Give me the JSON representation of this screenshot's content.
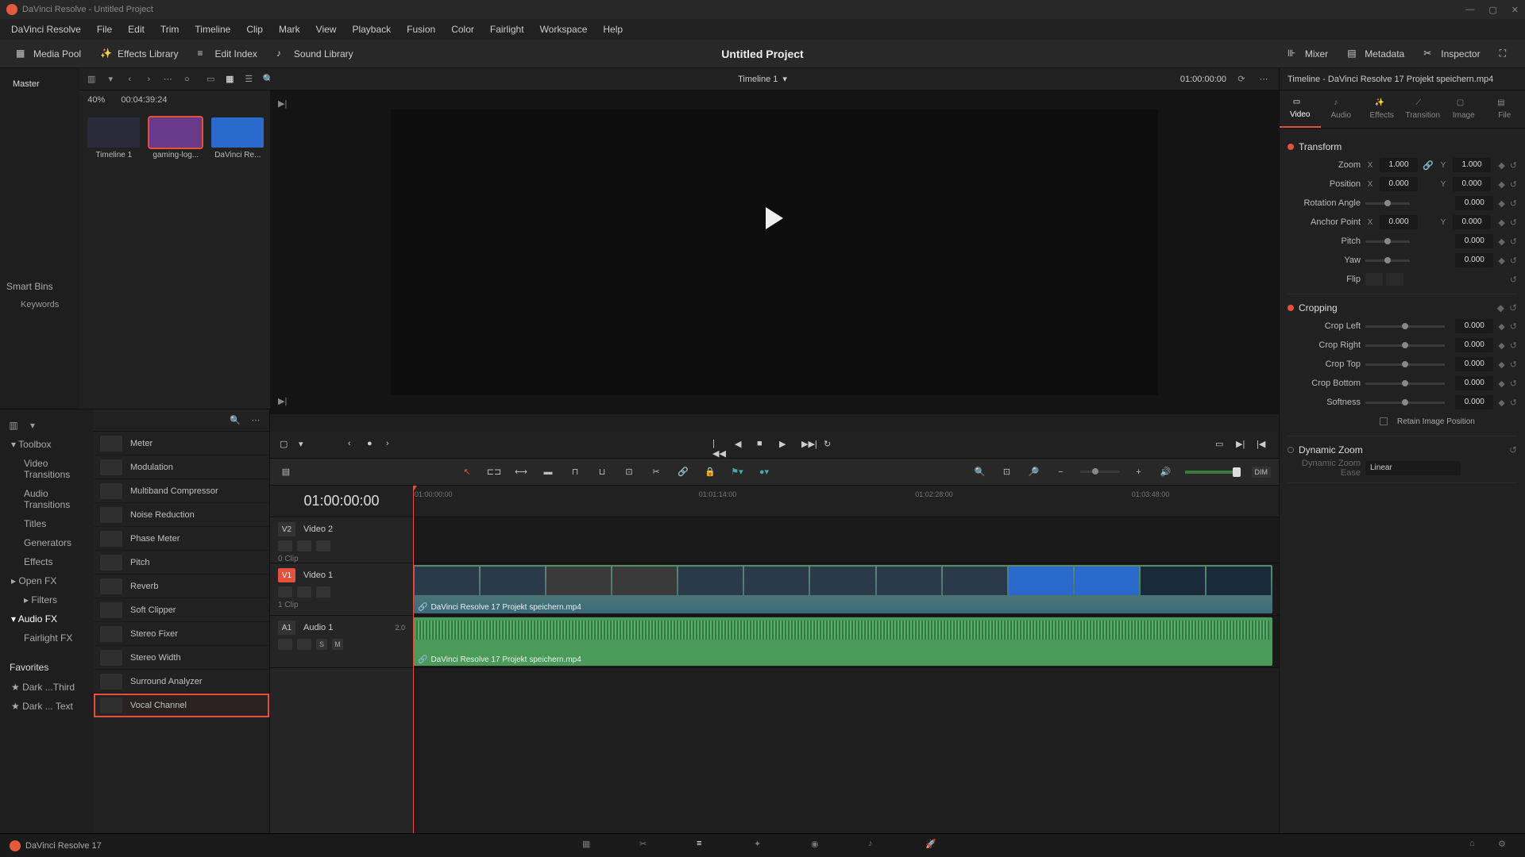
{
  "titlebar": {
    "text": "DaVinci Resolve - Untitled Project"
  },
  "menu": [
    "DaVinci Resolve",
    "File",
    "Edit",
    "Trim",
    "Timeline",
    "Clip",
    "Mark",
    "View",
    "Playback",
    "Fusion",
    "Color",
    "Fairlight",
    "Workspace",
    "Help"
  ],
  "toolbar": {
    "media_pool": "Media Pool",
    "effects_library": "Effects Library",
    "edit_index": "Edit Index",
    "sound_library": "Sound Library",
    "mixer": "Mixer",
    "metadata": "Metadata",
    "inspector": "Inspector"
  },
  "project_title": "Untitled Project",
  "media_tree": {
    "master": "Master",
    "smart_bins": "Smart Bins",
    "keywords": "Keywords"
  },
  "thumbs_toolbar": {
    "zoom": "40%",
    "tc": "00:04:39:24"
  },
  "thumbs": [
    {
      "label": "Timeline 1"
    },
    {
      "label": "gaming-log..."
    },
    {
      "label": "DaVinci Re..."
    }
  ],
  "viewer": {
    "title": "Timeline 1",
    "tc_right": "01:00:00:00"
  },
  "fx_tree": {
    "toolbox": "Toolbox",
    "video_trans": "Video Transitions",
    "audio_trans": "Audio Transitions",
    "titles": "Titles",
    "generators": "Generators",
    "effects": "Effects",
    "openfx": "Open FX",
    "filters": "Filters",
    "audiofx": "Audio FX",
    "fairlight": "Fairlight FX",
    "favorites": "Favorites",
    "fav1": "Dark ...Third",
    "fav2": "Dark ... Text"
  },
  "fx_list": [
    "Meter",
    "Modulation",
    "Multiband Compressor",
    "Noise Reduction",
    "Phase Meter",
    "Pitch",
    "Reverb",
    "Soft Clipper",
    "Stereo Fixer",
    "Stereo Width",
    "Surround Analyzer",
    "Vocal Channel"
  ],
  "timeline": {
    "tc": "01:00:00:00",
    "ruler": [
      "01:00:00:00",
      "01:01:14:00",
      "01:02:28:00",
      "01:03:48:00"
    ],
    "v2": {
      "badge": "V2",
      "name": "Video 2",
      "count": "0 Clip"
    },
    "v1": {
      "badge": "V1",
      "name": "Video 1",
      "count": "1 Clip",
      "clip": "DaVinci Resolve 17 Projekt speichern.mp4"
    },
    "a1": {
      "badge": "A1",
      "name": "Audio 1",
      "meter": "2.0",
      "clip": "DaVinci Resolve 17 Projekt speichern.mp4",
      "s": "S",
      "m": "M"
    }
  },
  "inspector": {
    "title": "Timeline - DaVinci Resolve 17 Projekt speichern.mp4",
    "tabs": [
      "Video",
      "Audio",
      "Effects",
      "Transition",
      "Image",
      "File"
    ],
    "transform": {
      "header": "Transform",
      "zoom": "Zoom",
      "zoom_x": "1.000",
      "zoom_y": "1.000",
      "position": "Position",
      "pos_x": "0.000",
      "pos_y": "0.000",
      "rotation": "Rotation Angle",
      "rot_v": "0.000",
      "anchor": "Anchor Point",
      "anc_x": "0.000",
      "anc_y": "0.000",
      "pitch": "Pitch",
      "pitch_v": "0.000",
      "yaw": "Yaw",
      "yaw_v": "0.000",
      "flip": "Flip"
    },
    "cropping": {
      "header": "Cropping",
      "left": "Crop Left",
      "left_v": "0.000",
      "right": "Crop Right",
      "right_v": "0.000",
      "top": "Crop Top",
      "top_v": "0.000",
      "bottom": "Crop Bottom",
      "bottom_v": "0.000",
      "softness": "Softness",
      "soft_v": "0.000",
      "retain": "Retain Image Position"
    },
    "dynzoom": {
      "header": "Dynamic Zoom",
      "ease": "Dynamic Zoom Ease",
      "linear": "Linear"
    }
  },
  "pagebar": {
    "brand": "DaVinci Resolve 17"
  },
  "vol_dim": "DIM"
}
